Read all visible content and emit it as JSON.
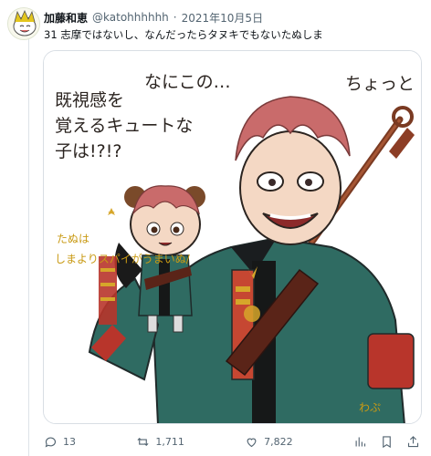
{
  "tweet": {
    "display_name": "加藤和恵",
    "handle": "@katohhhhhh",
    "separator": "·",
    "date": "2021年10月5日",
    "text": "31 志摩ではないし、なんだったらタヌキでもないたぬしま"
  },
  "illustration": {
    "line1": "ちょっと",
    "line2": "なにこの…",
    "line3": "既視感を",
    "line4": "覚えるキュートな",
    "line5": "子は!?!?",
    "side1": "たぬは",
    "side2": "しまよりスパイがうまいぬ/",
    "signature": "わぷ"
  },
  "actions": {
    "replies": "13",
    "retweets": "1,711",
    "likes": "7,822"
  },
  "colors": {
    "text": "#0f1419",
    "muted": "#536471",
    "border": "#d8dee4",
    "hair": "#c96b6b",
    "uniform": "#2f6b62",
    "gold": "#d6a62a"
  },
  "icons": [
    "avatar-icon",
    "reply-icon",
    "retweet-icon",
    "like-icon",
    "stats-icon",
    "bookmark-icon",
    "share-icon"
  ]
}
